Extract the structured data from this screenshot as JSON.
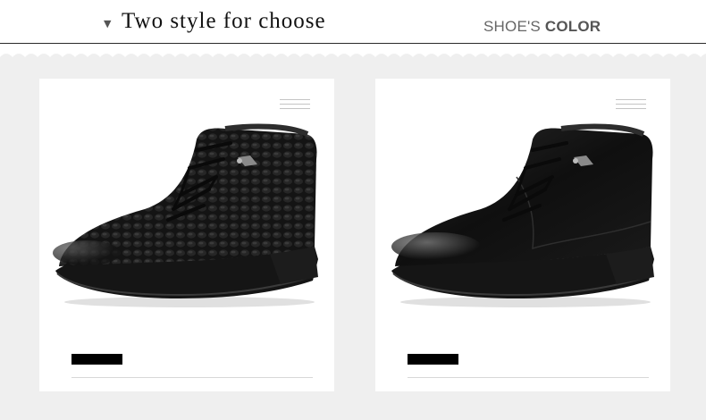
{
  "header": {
    "triangle_glyph": "▼",
    "title": "Two style for choose",
    "color_label_prefix": "SHOE'S ",
    "color_label_bold": "COLOR"
  },
  "products": [
    {
      "style": "crocodile-embossed leather chukka boot",
      "color": "black",
      "menu_icon": "menu-lines-icon"
    },
    {
      "style": "smooth leather chukka boot",
      "color": "black",
      "menu_icon": "menu-lines-icon"
    }
  ],
  "colors": {
    "background_gray": "#efefef",
    "card_white": "#ffffff",
    "shoe_black": "#111111"
  }
}
